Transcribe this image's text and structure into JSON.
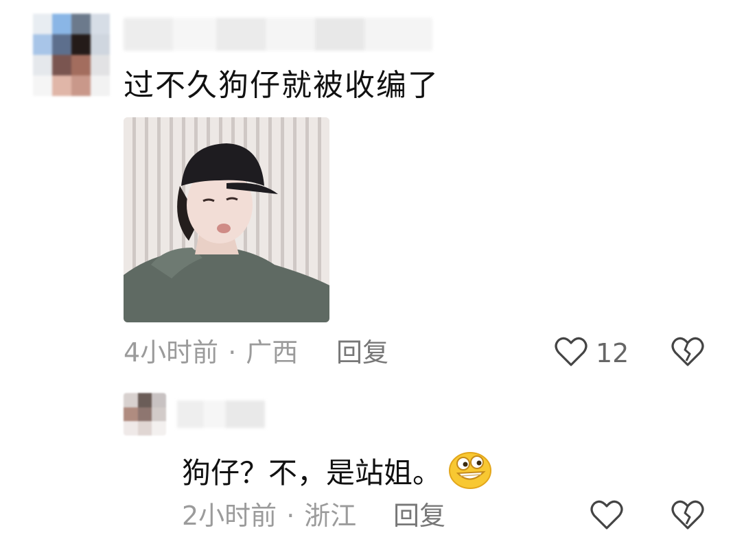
{
  "comment": {
    "text": "过不久狗仔就被收编了",
    "time": "4小时前",
    "location": "广西",
    "separator": "·",
    "reply_label": "回复",
    "like_count": "12"
  },
  "reply": {
    "text": "狗仔？不，是站姐。",
    "emoji": "grinning-emoji",
    "time": "2小时前",
    "location": "浙江",
    "separator": "·",
    "reply_label": "回复"
  },
  "colors": {
    "meta_text": "#9b9b9b",
    "main_text": "#111111",
    "icon_stroke": "#444444"
  },
  "icons": [
    "heart-icon",
    "broken-heart-icon"
  ]
}
